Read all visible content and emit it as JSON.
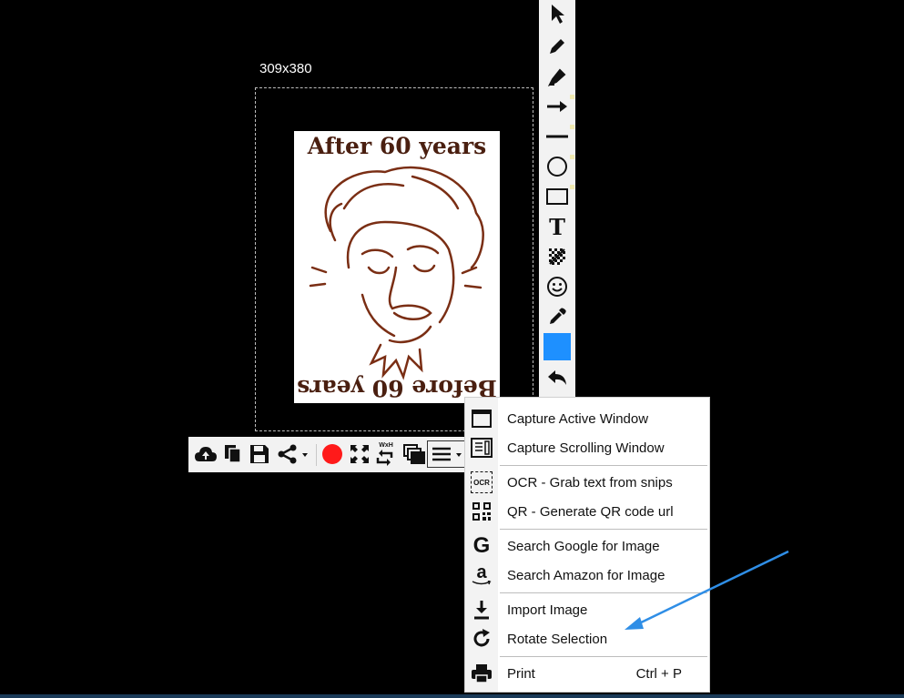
{
  "selection": {
    "size_label": "309x380"
  },
  "image": {
    "caption_top": "After 60 years",
    "caption_bottom": "Before 60 years"
  },
  "colors": {
    "accent": "#1e90ff",
    "record": "#ff1a1a",
    "annotation_arrow": "#2f8ee6",
    "sketch": "#7a2e14"
  },
  "vertical_toolbar": {
    "tools": [
      "pointer-icon",
      "pen-icon",
      "highlighter-icon",
      "arrow-icon",
      "line-icon",
      "ellipse-icon",
      "rectangle-icon",
      "text-icon",
      "pixelate-icon",
      "emoji-icon",
      "color-picker-icon",
      "color-swatch",
      "undo-icon"
    ],
    "text_tool_glyph": "T"
  },
  "bottom_toolbar": {
    "tools": [
      "upload-cloud-icon",
      "copy-icon",
      "save-icon",
      "share-icon",
      "record-icon",
      "fit-screen-icon",
      "resize-icon",
      "pin-icon",
      "menu-icon"
    ],
    "resize_label": "WxH"
  },
  "menu": {
    "items": [
      {
        "label": "Capture Active Window",
        "icon": "window-icon"
      },
      {
        "label": "Capture Scrolling Window",
        "icon": "scroll-window-icon"
      },
      {
        "label": "OCR - Grab text from snips",
        "icon": "ocr-icon",
        "icon_text": "OCR"
      },
      {
        "label": "QR - Generate QR code url",
        "icon": "qr-code-icon"
      },
      {
        "label": "Search Google for Image",
        "icon": "google-icon",
        "icon_text": "G"
      },
      {
        "label": "Search Amazon for Image",
        "icon": "amazon-icon",
        "icon_text": "a"
      },
      {
        "label": "Import Image",
        "icon": "download-icon"
      },
      {
        "label": "Rotate Selection",
        "icon": "rotate-icon"
      },
      {
        "label": "Print",
        "icon": "printer-icon",
        "shortcut": "Ctrl + P"
      }
    ]
  }
}
